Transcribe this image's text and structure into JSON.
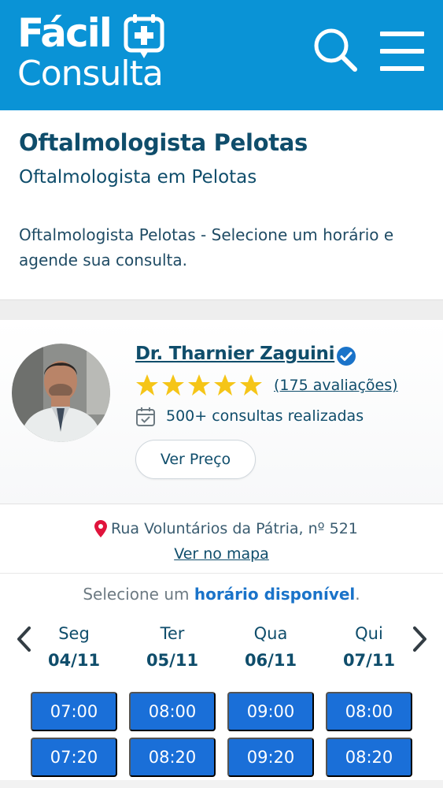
{
  "header": {
    "logo_line1": "Fácil",
    "logo_line2": "Consulta",
    "brand_color": "#0a93d6",
    "icons": [
      "calendar-plus-icon",
      "search-icon",
      "hamburger-menu-icon"
    ]
  },
  "page": {
    "title": "Oftalmologista Pelotas",
    "subtitle": "Oftalmologista em Pelotas",
    "description": "Oftalmologista Pelotas - Selecione um horário e agende sua consulta."
  },
  "doctor": {
    "name": "Dr. Tharnier Zaguini",
    "rating_stars": 5,
    "reviews_label": "(175 avaliações)",
    "consults_label": "500+ consultas realizadas",
    "price_button": "Ver Preço",
    "star_color": "#f5c518",
    "verified_color": "#1a73c9"
  },
  "address": {
    "text": "Rua Voluntários da Pátria, nº 521",
    "map_link": "Ver no mapa",
    "pin_color": "#e0143c"
  },
  "schedule": {
    "prompt_prefix": "Selecione um ",
    "prompt_highlight": "horário disponível",
    "prompt_suffix": ".",
    "days": [
      {
        "name": "Seg",
        "date": "04/11",
        "slots": [
          "07:00",
          "07:20"
        ]
      },
      {
        "name": "Ter",
        "date": "05/11",
        "slots": [
          "08:00",
          "08:20"
        ]
      },
      {
        "name": "Qua",
        "date": "06/11",
        "slots": [
          "09:00",
          "09:20"
        ]
      },
      {
        "name": "Qui",
        "date": "07/11",
        "slots": [
          "08:00",
          "08:20"
        ]
      }
    ],
    "slot_color": "#1a6fd8"
  }
}
